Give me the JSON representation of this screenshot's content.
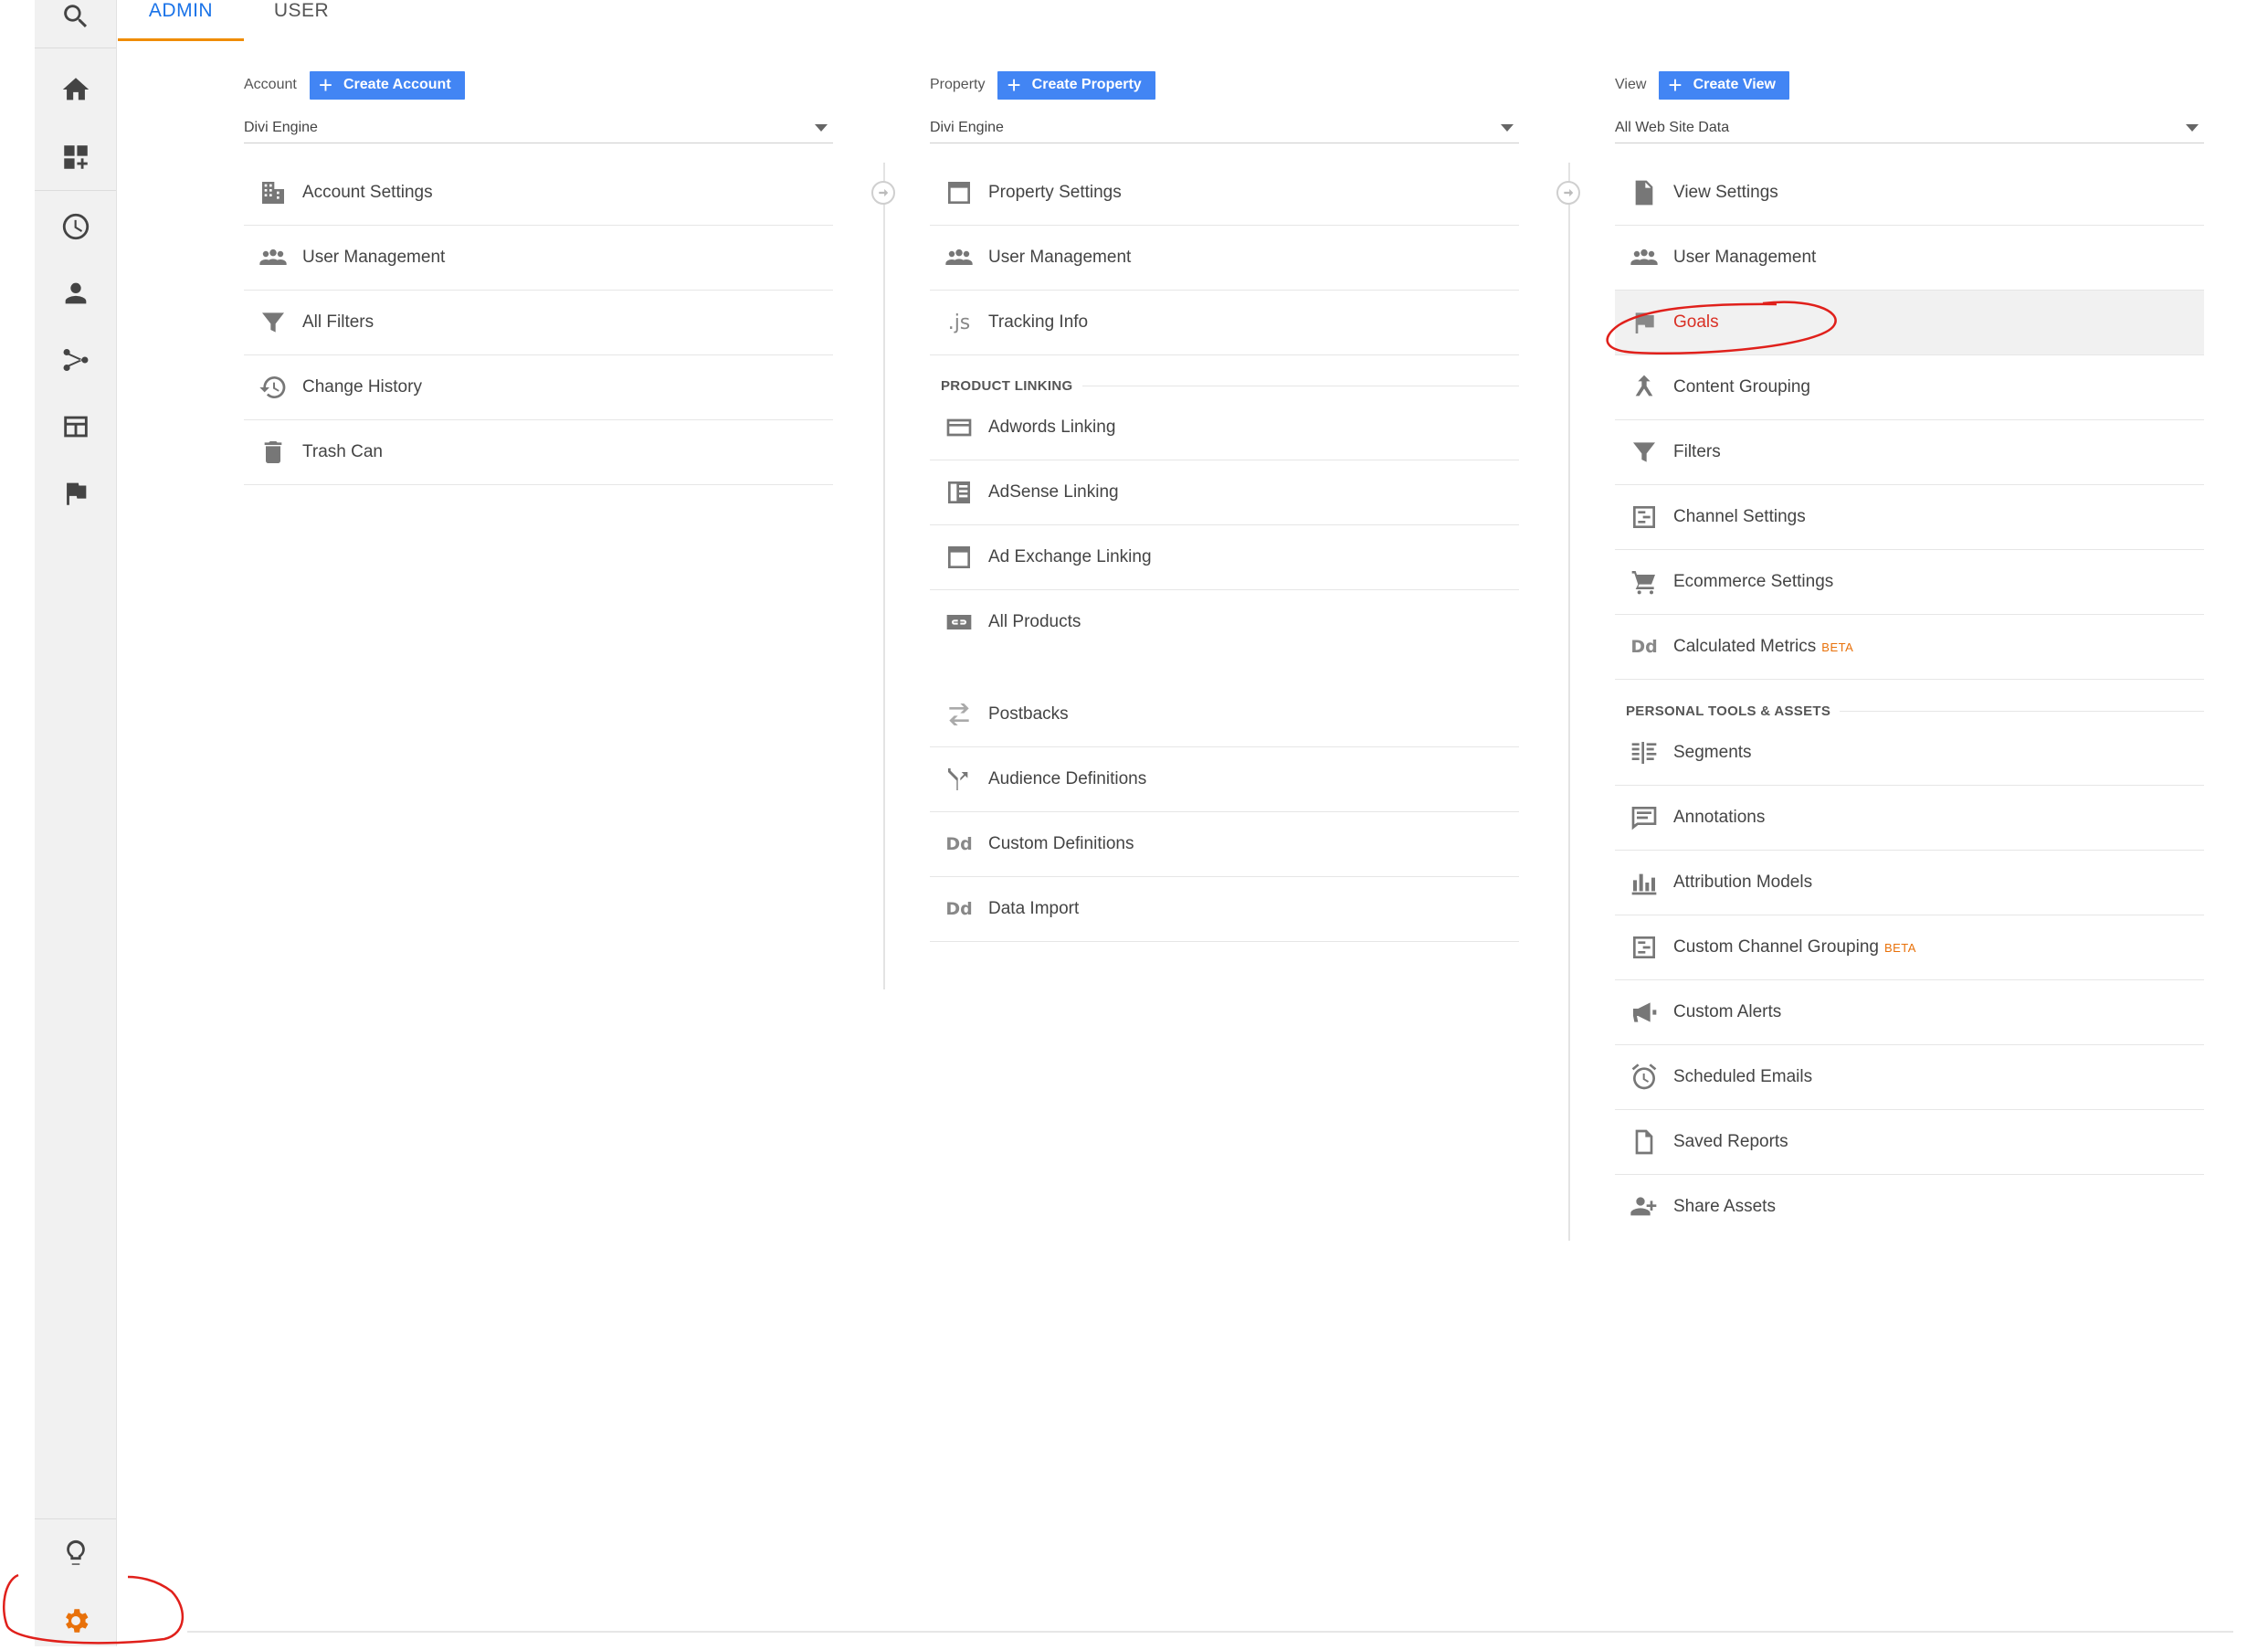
{
  "tabs": {
    "admin": "ADMIN",
    "user": "USER"
  },
  "account": {
    "label": "Account",
    "create_label": "Create Account",
    "selected": "Divi Engine",
    "items": [
      {
        "label": "Account Settings",
        "icon": "building-icon"
      },
      {
        "label": "User Management",
        "icon": "people-icon"
      },
      {
        "label": "All Filters",
        "icon": "filter-icon"
      },
      {
        "label": "Change History",
        "icon": "history-icon"
      },
      {
        "label": "Trash Can",
        "icon": "trash-icon"
      }
    ]
  },
  "property": {
    "label": "Property",
    "create_label": "Create Property",
    "selected": "Divi Engine",
    "items": [
      {
        "label": "Property Settings",
        "icon": "window-icon"
      },
      {
        "label": "User Management",
        "icon": "people-icon"
      },
      {
        "label": "Tracking Info",
        "icon": "js-icon",
        "glyph": ".js"
      }
    ],
    "section_product_linking": "PRODUCT LINKING",
    "linking_items": [
      {
        "label": "Adwords Linking",
        "icon": "adwords-icon"
      },
      {
        "label": "AdSense Linking",
        "icon": "adsense-icon"
      },
      {
        "label": "Ad Exchange Linking",
        "icon": "window-icon"
      },
      {
        "label": "All Products",
        "icon": "link-icon"
      }
    ],
    "other_items": [
      {
        "label": "Postbacks",
        "icon": "postbacks-icon"
      },
      {
        "label": "Audience Definitions",
        "icon": "fork-icon"
      },
      {
        "label": "Custom Definitions",
        "icon": "dd-icon",
        "glyph": "Dd"
      },
      {
        "label": "Data Import",
        "icon": "dd-icon",
        "glyph": "Dd"
      }
    ]
  },
  "view": {
    "label": "View",
    "create_label": "Create View",
    "selected": "All Web Site Data",
    "items": [
      {
        "label": "View Settings",
        "icon": "document-icon"
      },
      {
        "label": "User Management",
        "icon": "people-icon"
      },
      {
        "label": "Goals",
        "icon": "flag-icon",
        "active": true
      },
      {
        "label": "Content Grouping",
        "icon": "grouping-icon"
      },
      {
        "label": "Filters",
        "icon": "filter-icon"
      },
      {
        "label": "Channel Settings",
        "icon": "channel-icon"
      },
      {
        "label": "Ecommerce Settings",
        "icon": "cart-icon"
      },
      {
        "label": "Calculated Metrics",
        "icon": "dd-icon",
        "glyph": "Dd",
        "beta": "BETA"
      }
    ],
    "section_personal": "PERSONAL TOOLS & ASSETS",
    "personal_items": [
      {
        "label": "Segments",
        "icon": "segments-icon"
      },
      {
        "label": "Annotations",
        "icon": "annotation-icon"
      },
      {
        "label": "Attribution Models",
        "icon": "bar-chart-icon"
      },
      {
        "label": "Custom Channel Grouping",
        "icon": "channel-icon",
        "beta": "BETA"
      },
      {
        "label": "Custom Alerts",
        "icon": "megaphone-icon"
      },
      {
        "label": "Scheduled Emails",
        "icon": "alarm-icon"
      },
      {
        "label": "Saved Reports",
        "icon": "file-icon"
      },
      {
        "label": "Share Assets",
        "icon": "person-add-icon"
      }
    ]
  },
  "rail": {
    "icons": [
      "search-icon",
      "home-icon",
      "dashboard-icon",
      "clock-icon",
      "person-icon",
      "share-icon",
      "layout-icon",
      "flag-icon"
    ],
    "bottom_icons": [
      "lightbulb-icon",
      "gear-icon"
    ]
  },
  "colors": {
    "accent_blue": "#4285f4",
    "tab_active": "#1a73e8",
    "tab_underline": "#ef8c00",
    "gear_orange": "#e8710a",
    "annotation_red": "#e0201b",
    "active_text": "#d93025"
  }
}
